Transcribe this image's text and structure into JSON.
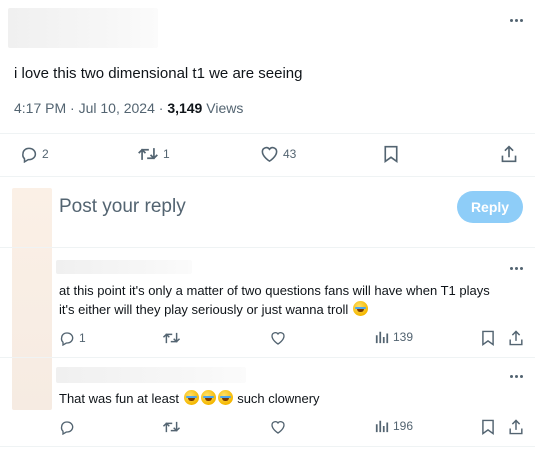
{
  "main_tweet": {
    "text": "i love this two dimensional t1 we are seeing",
    "time": "4:17 PM · Jul 10, 2024 · ",
    "views_count": "3,149",
    "views_label": " Views",
    "replies": "2",
    "reposts": "1",
    "likes": "43"
  },
  "composer": {
    "placeholder": "Post your reply",
    "button_label": "Reply"
  },
  "replies": [
    {
      "text_line1": "at this point it's only a matter of two questions fans will have when T1 plays",
      "text_line2": "it's either will they play seriously or just wanna troll",
      "replies": "1",
      "views": "139"
    },
    {
      "text_before": "That was fun at least",
      "text_after": " such clownery",
      "views": "196"
    }
  ],
  "icons": {
    "more": "more-icon",
    "reply": "reply-icon",
    "repost": "repost-icon",
    "like": "heart-icon",
    "bookmark": "bookmark-icon",
    "share": "share-icon",
    "views": "views-icon",
    "emoji": "rofl-emoji"
  },
  "colors": {
    "accent_disabled": "#8ecdf8",
    "secondary_text": "#536471",
    "divider": "#eff3f4"
  }
}
